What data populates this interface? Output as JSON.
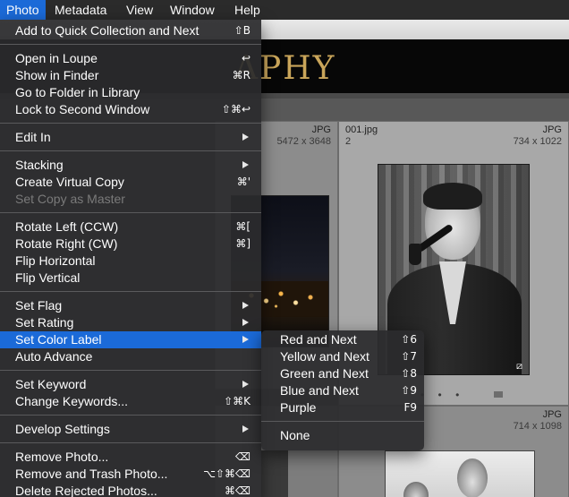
{
  "menubar": {
    "items": [
      {
        "label": "Photo",
        "active": true
      },
      {
        "label": "Metadata"
      },
      {
        "label": "View"
      },
      {
        "label": "Window"
      },
      {
        "label": "Help"
      }
    ]
  },
  "identity_plate": {
    "text": "APHY"
  },
  "grid": {
    "cells": [
      {
        "filename": "",
        "index": "",
        "ext": "JPG",
        "dims": "5472 x 3648"
      },
      {
        "filename": "001.jpg",
        "index": "2",
        "ext": "JPG",
        "dims": "734 x 1022"
      },
      {
        "filename": "",
        "index": "",
        "ext": "JPG",
        "dims": "714 x 1098"
      }
    ],
    "edit_badge": "⧄",
    "dots": "• • •"
  },
  "photo_menu": {
    "items": [
      {
        "label": "Add to Quick Collection and Next",
        "shortcut": "⇧B"
      },
      {
        "label": "Open in Loupe",
        "shortcut": "↩"
      },
      {
        "label": "Show in Finder",
        "shortcut": "⌘R"
      },
      {
        "label": "Go to Folder in Library",
        "shortcut": ""
      },
      {
        "label": "Lock to Second Window",
        "shortcut": "⇧⌘↩"
      },
      {
        "label": "Edit In",
        "shortcut": "",
        "submenu": true
      },
      {
        "label": "Stacking",
        "shortcut": "",
        "submenu": true
      },
      {
        "label": "Create Virtual Copy",
        "shortcut": "⌘'"
      },
      {
        "label": "Set Copy as Master",
        "shortcut": "",
        "disabled": true
      },
      {
        "label": "Rotate Left (CCW)",
        "shortcut": "⌘["
      },
      {
        "label": "Rotate Right (CW)",
        "shortcut": "⌘]"
      },
      {
        "label": "Flip Horizontal",
        "shortcut": ""
      },
      {
        "label": "Flip Vertical",
        "shortcut": ""
      },
      {
        "label": "Set Flag",
        "shortcut": "",
        "submenu": true
      },
      {
        "label": "Set Rating",
        "shortcut": "",
        "submenu": true
      },
      {
        "label": "Set Color Label",
        "shortcut": "",
        "submenu": true,
        "highlighted": true
      },
      {
        "label": "Auto Advance",
        "shortcut": ""
      },
      {
        "label": "Set Keyword",
        "shortcut": "",
        "submenu": true
      },
      {
        "label": "Change Keywords...",
        "shortcut": "⇧⌘K"
      },
      {
        "label": "Develop Settings",
        "shortcut": "",
        "submenu": true
      },
      {
        "label": "Remove Photo...",
        "shortcut": "⌫"
      },
      {
        "label": "Remove and Trash Photo...",
        "shortcut": "⌥⇧⌘⌫"
      },
      {
        "label": "Delete Rejected Photos...",
        "shortcut": "⌘⌫"
      }
    ]
  },
  "color_label_menu": {
    "items": [
      {
        "label": "Red and Next",
        "shortcut": "⇧6"
      },
      {
        "label": "Yellow and Next",
        "shortcut": "⇧7"
      },
      {
        "label": "Green and Next",
        "shortcut": "⇧8"
      },
      {
        "label": "Blue and Next",
        "shortcut": "⇧9"
      },
      {
        "label": "Purple",
        "shortcut": "F9"
      },
      {
        "label": "None",
        "shortcut": ""
      }
    ]
  },
  "colors": {
    "highlight": "#1b6ad8",
    "menu_bg": "#2b2b2d",
    "identity_text": "#c9a55a"
  }
}
